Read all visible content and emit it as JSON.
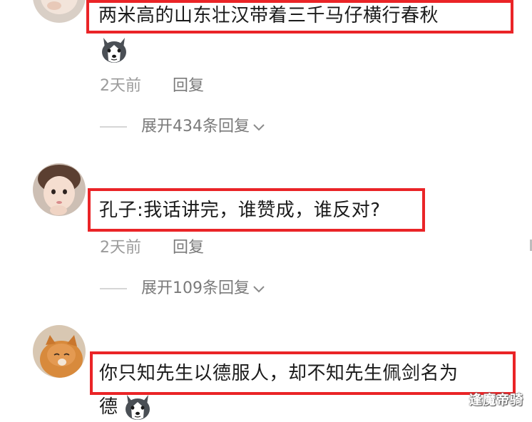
{
  "comments": [
    {
      "text": "两米高的山东壮汉带着三千马仔横行春秋",
      "emoji": "husky-emoji",
      "time": "2天前",
      "reply_label": "回复",
      "expand_label": "展开434条回复"
    },
    {
      "text": "孔子:我话讲完，谁赞成，谁反对?",
      "time": "2天前",
      "reply_label": "回复",
      "expand_label": "展开109条回复"
    },
    {
      "text_line1": "你只知先生以德服人，却不知先生佩剑名为",
      "text_line2": "德",
      "emoji": "husky-emoji"
    }
  ],
  "watermark": "逢魔帝骑",
  "colors": {
    "highlight": "#ea2427",
    "meta_gray": "#9b9b9b",
    "text_dark": "#1b1b1b"
  }
}
